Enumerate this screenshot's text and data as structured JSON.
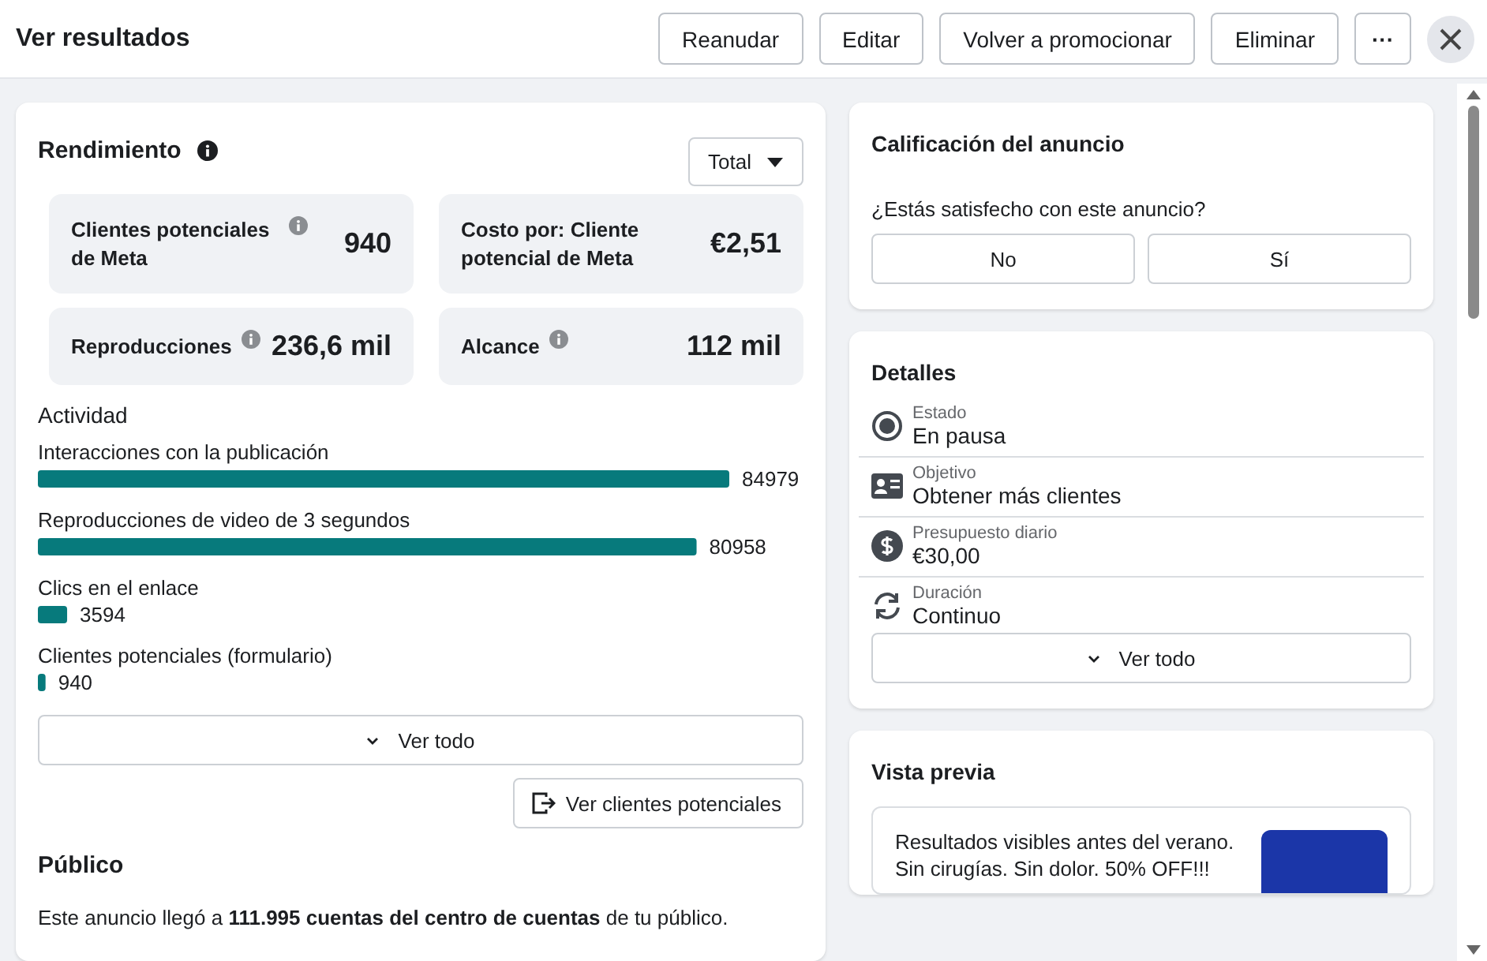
{
  "header": {
    "title": "Ver resultados",
    "actions": [
      "Reanudar",
      "Editar",
      "Volver a promocionar",
      "Eliminar"
    ],
    "more": "···"
  },
  "performance": {
    "title": "Rendimiento",
    "period": "Total",
    "metrics": [
      {
        "label": "Clientes potenciales de Meta",
        "value": "940",
        "info": true
      },
      {
        "label": "Costo por: Cliente potencial de Meta",
        "value": "€2,51",
        "info": false
      },
      {
        "label": "Reproducciones",
        "value": "236,6 mil",
        "info": true
      },
      {
        "label": "Alcance",
        "value": "112 mil",
        "info": true
      }
    ],
    "activity": {
      "chart_data": {
        "type": "bar",
        "orientation": "horizontal",
        "title": "Actividad",
        "categories": [
          "Interacciones con la publicación",
          "Reproducciones de video de 3 segundos",
          "Clics en el enlace",
          "Clientes potenciales (formulario)"
        ],
        "values": [
          84979,
          80958,
          3594,
          940
        ],
        "data_labels": true
      }
    },
    "see_all": "Ver todo",
    "view_leads": "Ver clientes potenciales"
  },
  "audience": {
    "title": "Público",
    "text": "Este anuncio llegó a **111.995 cuentas del centro de cuentas** de tu público."
  },
  "rating": {
    "title": "Calificación del anuncio",
    "question": "¿Estás satisfecho con este anuncio?",
    "options": [
      "No",
      "Sí"
    ]
  },
  "details": {
    "title": "Detalles",
    "items": [
      {
        "kind": "status",
        "label": "Estado",
        "value": "En pausa"
      },
      {
        "kind": "objective",
        "label": "Objetivo",
        "value": "Obtener más clientes"
      },
      {
        "kind": "budget",
        "label": "Presupuesto diario",
        "value": "€30,00"
      },
      {
        "kind": "duration",
        "label": "Duración",
        "value": "Continuo"
      }
    ],
    "see_all": "Ver todo"
  },
  "preview": {
    "title": "Vista previa",
    "lines": [
      "Resultados visibles antes del verano.",
      "Sin cirugías. Sin dolor. 50% OFF!!!"
    ]
  }
}
